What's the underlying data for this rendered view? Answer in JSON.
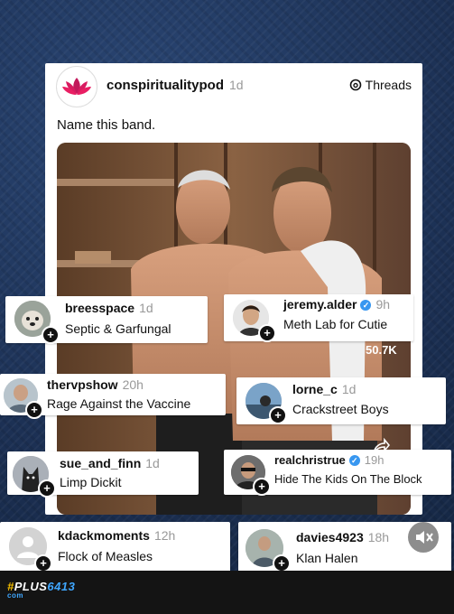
{
  "post": {
    "author": "conspiritualitypod",
    "age": "1d",
    "platform": "Threads",
    "text": "Name this band.",
    "views": "50.7K"
  },
  "comments": [
    {
      "user": "breesspace",
      "age": "1d",
      "text": "Septic & Garfungal",
      "verified": false
    },
    {
      "user": "jeremy.alder",
      "age": "9h",
      "text": "Meth Lab for Cutie",
      "verified": true
    },
    {
      "user": "thervpshow",
      "age": "20h",
      "text": "Rage Against the Vaccine",
      "verified": false
    },
    {
      "user": "lorne_c",
      "age": "1d",
      "text": "Crackstreet Boys",
      "verified": false
    },
    {
      "user": "sue_and_finn",
      "age": "1d",
      "text": "Limp Dickit",
      "verified": false
    },
    {
      "user": "realchristrue",
      "age": "19h",
      "text": "Hide The Kids On The Block",
      "verified": true
    },
    {
      "user": "kdackmoments",
      "age": "12h",
      "text": "Flock of Measles",
      "verified": false
    },
    {
      "user": "davies4923",
      "age": "18h",
      "text": "Klan Halen",
      "verified": false
    }
  ],
  "watermark": {
    "hash": "#",
    "brand": "PLUS",
    "number": "6413",
    "sub": "com"
  },
  "colors": {
    "background": "#1d3358",
    "accent": "#3fa7ff",
    "verified": "#3897f0"
  },
  "icons": {
    "threads": "threads-logo-icon",
    "mute": "speaker-muted-icon",
    "follow": "plus-icon",
    "share": "share-icon"
  }
}
